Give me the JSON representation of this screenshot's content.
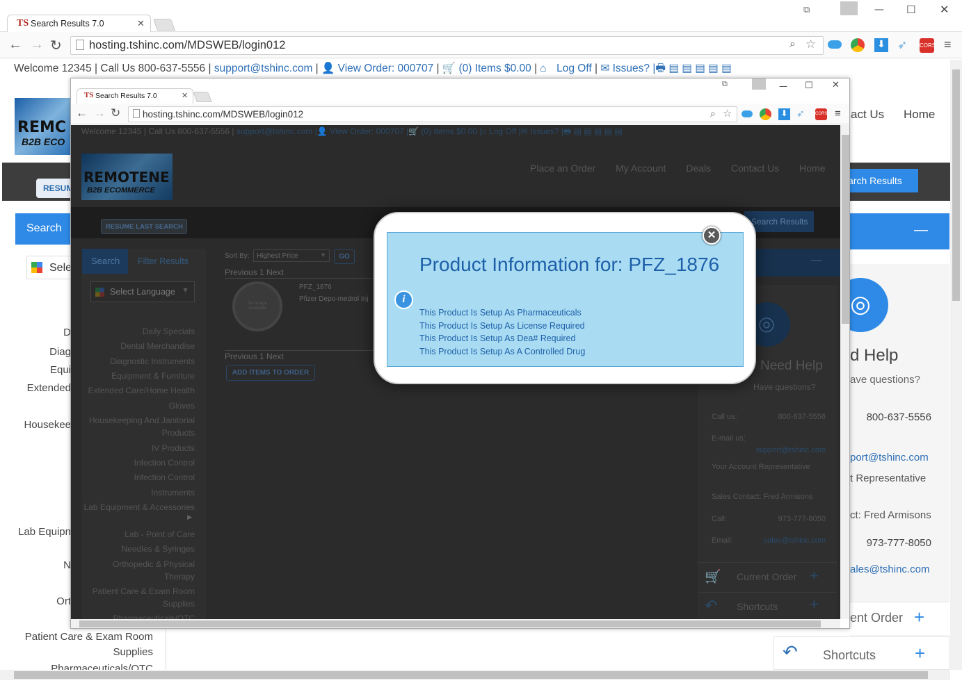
{
  "browser": {
    "tab_title": "Search Results 7.0",
    "tab_logo": "TS",
    "url": "hosting.tshinc.com/MDSWEB/login012",
    "ext_label": "CORS"
  },
  "site": {
    "topbar": {
      "welcome": "Welcome 12345",
      "call_us": "Call Us 800-637-5556",
      "email": "support@tshinc.com",
      "view_order": "View Order: 000707",
      "cart": "(0) Items $0.00",
      "logoff": "Log Off",
      "issues": "Issues?"
    },
    "logo_line1": "REMOTENE",
    "logo_line2": "B2B ECOMMERCE",
    "nav": [
      "Place an Order",
      "My Account",
      "Deals",
      "Contact Us",
      "Home"
    ],
    "resume_btn": "RESUME LAST SEARCH",
    "search_results_btn": "Search Results",
    "sidebar_tabs": {
      "search": "Search",
      "filter": "Filter Results"
    },
    "select_language": "Select Language",
    "categories": [
      "Daily Specials",
      "Dental Merchandise",
      "Diagnostic Instruments",
      "Equipment & Furniture",
      "Extended Care/Home Health",
      "Gloves",
      "Housekeeping And Janitorial Products",
      "IV Products",
      "Infection Control",
      "Infection Control",
      "Instruments",
      "Lab Equipment & Accessories",
      "Lab - Point of Care",
      "Needles & Syringes",
      "Orthopedic & Physical Therapy",
      "Patient Care & Exam Room Supplies",
      "Pharmaceuticals/OTC"
    ],
    "sort_by_label": "Sort By:",
    "sort_value": "Highest Price",
    "go_btn": "GO",
    "pager": "Previous  1  Next",
    "product_code": "PFZ_1876",
    "product_desc": "Pfizer Depo-medrol Inj",
    "no_image": "No Image Available",
    "add_items": "ADD ITEMS TO ORDER",
    "help": {
      "title": "Need Help",
      "subtitle": "Have questions?",
      "call_label": "Call us:",
      "call_value": "800-637-5556",
      "email_label": "E-mail us:",
      "email_value": "support@tshinc.com",
      "rep_label": "Your Account Representative",
      "sales_contact": "Sales Contact: Fred Armisons",
      "call2_label": "Call:",
      "call2_value": "973-777-8050",
      "email2_label": "Email:",
      "email2_value": "sales@tshinc.com"
    },
    "current_order": "Current Order",
    "shortcuts": "Shortcuts"
  },
  "back": {
    "logo_line1": "REMC",
    "logo_line2": "B2B ECO",
    "nav_contact": "act Us",
    "nav_home": "Home",
    "resume_btn": "RESUM",
    "search_results_btn": "arch Results",
    "search_tab": "Search",
    "select_lang": "Sele",
    "left_fragments": [
      "D",
      "Diag",
      "Equi",
      "Extended",
      "Housekee",
      "Lab Equipn",
      "N",
      "Ort"
    ],
    "patient_line1": "Patient Care & Exam Room",
    "patient_line2": "Supplies",
    "pharma": "Pharmaceuticals/OTC",
    "help_title": "d Help",
    "help_sub": "ave questions?",
    "help_phone": "800-637-5556",
    "help_email": "port@tshinc.com",
    "help_rep": "t Representative",
    "help_sales": "ct: Fred Armisons",
    "help_phone2": "973-777-8050",
    "help_email2": "ales@tshinc.com",
    "current_order": "ent Order",
    "shortcuts": "Shortcuts"
  },
  "modal": {
    "title": "Product Information for: PFZ_1876",
    "lines": [
      "This Product Is Setup As Pharmaceuticals",
      "This Product Is Setup As License Required",
      "This Product Is Setup As Dea# Required",
      "This Product Is Setup As A Controlled Drug"
    ]
  },
  "colors": {
    "accent": "#2e8ae6",
    "link": "#2e6fb5",
    "modal_bg": "#a9dcf3",
    "nav_dark": "#3a3a3a"
  }
}
